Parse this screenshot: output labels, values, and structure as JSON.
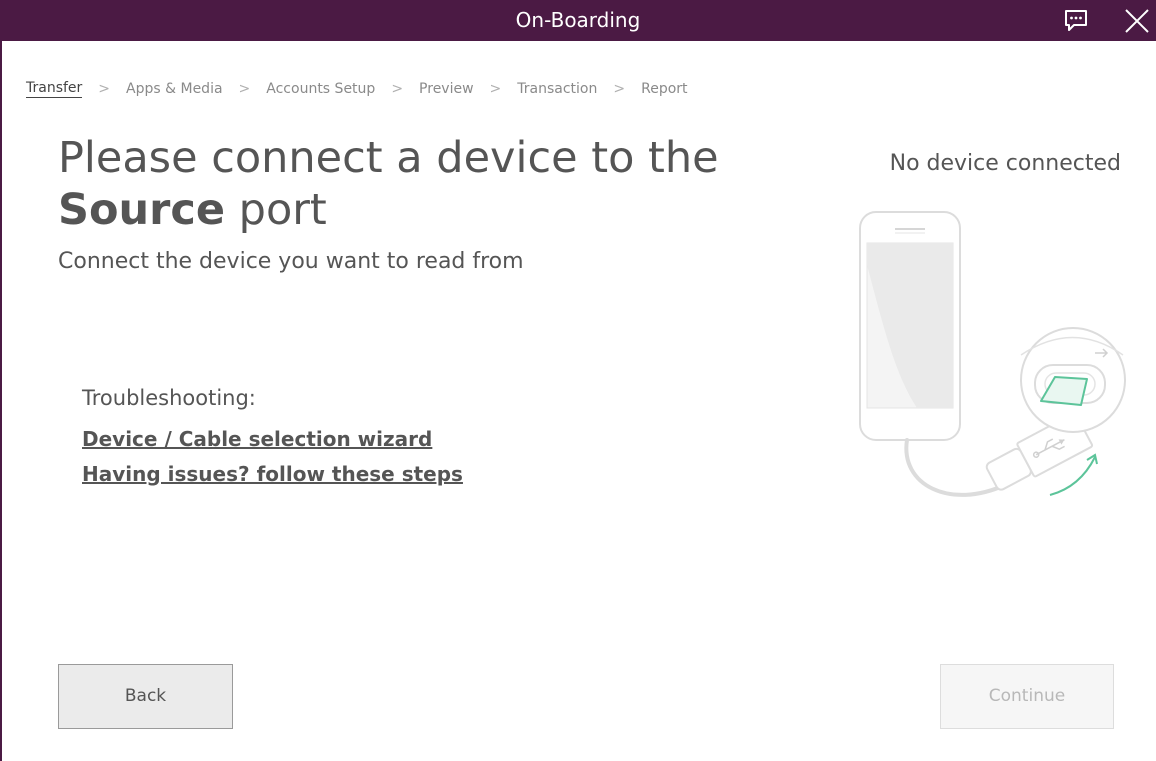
{
  "window": {
    "title": "On-Boarding",
    "chat_icon": "chat-bubble-icon",
    "close_icon": "close-icon"
  },
  "breadcrumb": [
    {
      "label": "Transfer",
      "active": true
    },
    {
      "label": "Apps & Media",
      "active": false
    },
    {
      "label": "Accounts Setup",
      "active": false
    },
    {
      "label": "Preview",
      "active": false
    },
    {
      "label": "Transaction",
      "active": false
    },
    {
      "label": "Report",
      "active": false
    }
  ],
  "main": {
    "heading_line1": "Please connect a device to the",
    "heading_bold": "Source",
    "heading_rest": " port",
    "subheading": "Connect the device you want to read from",
    "troubleshooting_label": "Troubleshooting:",
    "link_wizard": "Device / Cable selection wizard",
    "link_issues": "Having issues? follow these steps",
    "device_status": "No device connected"
  },
  "buttons": {
    "back": "Back",
    "continue": "Continue"
  },
  "colors": {
    "titlebar": "#4b1a44",
    "accent_green": "#5cc49a"
  }
}
